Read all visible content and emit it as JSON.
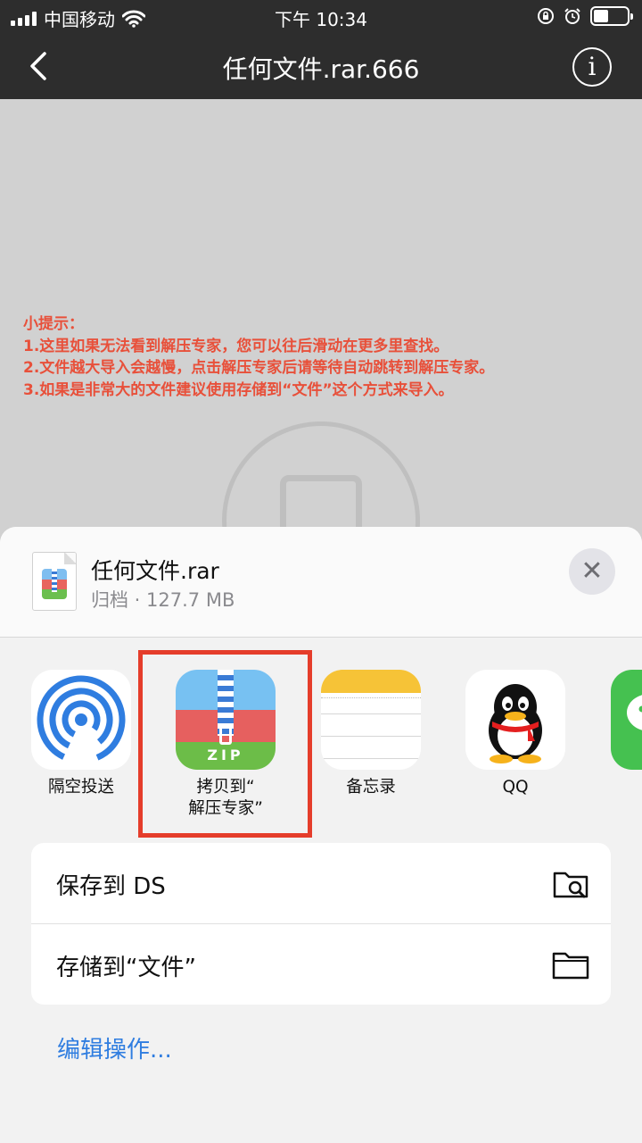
{
  "status_bar": {
    "carrier": "中国移动",
    "time": "下午 10:34"
  },
  "nav": {
    "title": "任何文件.rar.666",
    "back_icon": "chevron-left-icon",
    "info_icon": "info-circle-icon"
  },
  "tips": {
    "heading": "小提示：",
    "line1": "1.这里如果无法看到解压专家，您可以往后滑动在更多里查找。",
    "line2": "2.文件越大导入会越慢，点击解压专家后请等待自动跳转到解压专家。",
    "line3": "3.如果是非常大的文件建议使用存储到“文件”这个方式来导入。"
  },
  "sheet": {
    "file_name": "任何文件.rar",
    "file_meta": "归档 · 127.7 MB",
    "close_icon": "close-icon",
    "apps": [
      {
        "label": "隔空投送",
        "icon": "airdrop-icon"
      },
      {
        "label": "拷贝到“\n解压专家”",
        "icon": "zip-icon",
        "icon_text": "ZIP"
      },
      {
        "label": "备忘录",
        "icon": "notes-icon"
      },
      {
        "label": "QQ",
        "icon": "qq-icon"
      },
      {
        "label": "",
        "icon": "wechat-icon"
      }
    ],
    "actions": [
      {
        "label": "保存到 DS",
        "icon": "folder-search-icon"
      },
      {
        "label": "存储到“文件”",
        "icon": "folder-icon"
      }
    ],
    "edit_link": "编辑操作..."
  },
  "colors": {
    "tip_red": "#e8503a",
    "highlight_red": "#e53d2b",
    "link_blue": "#2f7de0",
    "nav_bg": "#2d2d2d"
  }
}
